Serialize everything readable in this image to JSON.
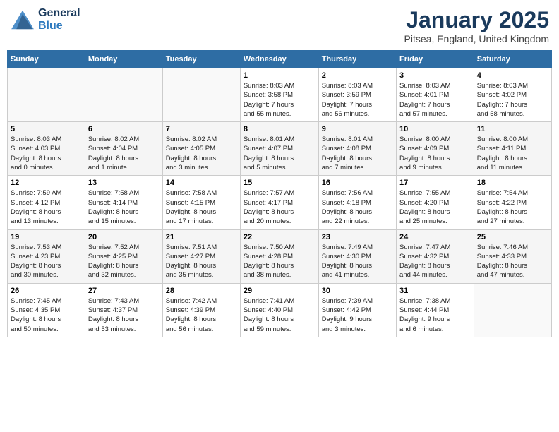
{
  "header": {
    "logo_line1": "General",
    "logo_line2": "Blue",
    "month": "January 2025",
    "location": "Pitsea, England, United Kingdom"
  },
  "weekdays": [
    "Sunday",
    "Monday",
    "Tuesday",
    "Wednesday",
    "Thursday",
    "Friday",
    "Saturday"
  ],
  "weeks": [
    [
      {
        "day": "",
        "info": ""
      },
      {
        "day": "",
        "info": ""
      },
      {
        "day": "",
        "info": ""
      },
      {
        "day": "1",
        "info": "Sunrise: 8:03 AM\nSunset: 3:58 PM\nDaylight: 7 hours\nand 55 minutes."
      },
      {
        "day": "2",
        "info": "Sunrise: 8:03 AM\nSunset: 3:59 PM\nDaylight: 7 hours\nand 56 minutes."
      },
      {
        "day": "3",
        "info": "Sunrise: 8:03 AM\nSunset: 4:01 PM\nDaylight: 7 hours\nand 57 minutes."
      },
      {
        "day": "4",
        "info": "Sunrise: 8:03 AM\nSunset: 4:02 PM\nDaylight: 7 hours\nand 58 minutes."
      }
    ],
    [
      {
        "day": "5",
        "info": "Sunrise: 8:03 AM\nSunset: 4:03 PM\nDaylight: 8 hours\nand 0 minutes."
      },
      {
        "day": "6",
        "info": "Sunrise: 8:02 AM\nSunset: 4:04 PM\nDaylight: 8 hours\nand 1 minute."
      },
      {
        "day": "7",
        "info": "Sunrise: 8:02 AM\nSunset: 4:05 PM\nDaylight: 8 hours\nand 3 minutes."
      },
      {
        "day": "8",
        "info": "Sunrise: 8:01 AM\nSunset: 4:07 PM\nDaylight: 8 hours\nand 5 minutes."
      },
      {
        "day": "9",
        "info": "Sunrise: 8:01 AM\nSunset: 4:08 PM\nDaylight: 8 hours\nand 7 minutes."
      },
      {
        "day": "10",
        "info": "Sunrise: 8:00 AM\nSunset: 4:09 PM\nDaylight: 8 hours\nand 9 minutes."
      },
      {
        "day": "11",
        "info": "Sunrise: 8:00 AM\nSunset: 4:11 PM\nDaylight: 8 hours\nand 11 minutes."
      }
    ],
    [
      {
        "day": "12",
        "info": "Sunrise: 7:59 AM\nSunset: 4:12 PM\nDaylight: 8 hours\nand 13 minutes."
      },
      {
        "day": "13",
        "info": "Sunrise: 7:58 AM\nSunset: 4:14 PM\nDaylight: 8 hours\nand 15 minutes."
      },
      {
        "day": "14",
        "info": "Sunrise: 7:58 AM\nSunset: 4:15 PM\nDaylight: 8 hours\nand 17 minutes."
      },
      {
        "day": "15",
        "info": "Sunrise: 7:57 AM\nSunset: 4:17 PM\nDaylight: 8 hours\nand 20 minutes."
      },
      {
        "day": "16",
        "info": "Sunrise: 7:56 AM\nSunset: 4:18 PM\nDaylight: 8 hours\nand 22 minutes."
      },
      {
        "day": "17",
        "info": "Sunrise: 7:55 AM\nSunset: 4:20 PM\nDaylight: 8 hours\nand 25 minutes."
      },
      {
        "day": "18",
        "info": "Sunrise: 7:54 AM\nSunset: 4:22 PM\nDaylight: 8 hours\nand 27 minutes."
      }
    ],
    [
      {
        "day": "19",
        "info": "Sunrise: 7:53 AM\nSunset: 4:23 PM\nDaylight: 8 hours\nand 30 minutes."
      },
      {
        "day": "20",
        "info": "Sunrise: 7:52 AM\nSunset: 4:25 PM\nDaylight: 8 hours\nand 32 minutes."
      },
      {
        "day": "21",
        "info": "Sunrise: 7:51 AM\nSunset: 4:27 PM\nDaylight: 8 hours\nand 35 minutes."
      },
      {
        "day": "22",
        "info": "Sunrise: 7:50 AM\nSunset: 4:28 PM\nDaylight: 8 hours\nand 38 minutes."
      },
      {
        "day": "23",
        "info": "Sunrise: 7:49 AM\nSunset: 4:30 PM\nDaylight: 8 hours\nand 41 minutes."
      },
      {
        "day": "24",
        "info": "Sunrise: 7:47 AM\nSunset: 4:32 PM\nDaylight: 8 hours\nand 44 minutes."
      },
      {
        "day": "25",
        "info": "Sunrise: 7:46 AM\nSunset: 4:33 PM\nDaylight: 8 hours\nand 47 minutes."
      }
    ],
    [
      {
        "day": "26",
        "info": "Sunrise: 7:45 AM\nSunset: 4:35 PM\nDaylight: 8 hours\nand 50 minutes."
      },
      {
        "day": "27",
        "info": "Sunrise: 7:43 AM\nSunset: 4:37 PM\nDaylight: 8 hours\nand 53 minutes."
      },
      {
        "day": "28",
        "info": "Sunrise: 7:42 AM\nSunset: 4:39 PM\nDaylight: 8 hours\nand 56 minutes."
      },
      {
        "day": "29",
        "info": "Sunrise: 7:41 AM\nSunset: 4:40 PM\nDaylight: 8 hours\nand 59 minutes."
      },
      {
        "day": "30",
        "info": "Sunrise: 7:39 AM\nSunset: 4:42 PM\nDaylight: 9 hours\nand 3 minutes."
      },
      {
        "day": "31",
        "info": "Sunrise: 7:38 AM\nSunset: 4:44 PM\nDaylight: 9 hours\nand 6 minutes."
      },
      {
        "day": "",
        "info": ""
      }
    ]
  ]
}
